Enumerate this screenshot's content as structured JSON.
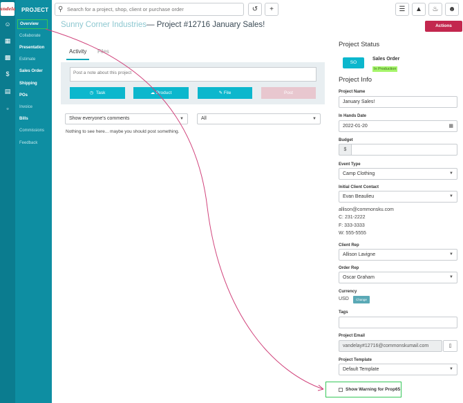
{
  "logo_text": "Vandelay",
  "rail_icons": [
    "users-icon",
    "chart-icon",
    "calculator-icon",
    "dollar-icon",
    "building-icon",
    "book-icon"
  ],
  "nav": {
    "title": "PROJECT",
    "items": [
      {
        "label": "Overview"
      },
      {
        "label": "Collaborate"
      },
      {
        "label": "Presentation"
      },
      {
        "label": "Estimate"
      },
      {
        "label": "Sales Order"
      },
      {
        "label": "Shipping"
      },
      {
        "label": "POs"
      },
      {
        "label": "Invoice"
      },
      {
        "label": "Bills"
      },
      {
        "label": "Commissions"
      },
      {
        "label": "Feedback"
      }
    ]
  },
  "search": {
    "placeholder": "Search for a project, shop, client or purchase order"
  },
  "header": {
    "client": "Sunny Corner Industries",
    "project": "— Project #12716 January Sales!",
    "actions_label": "Actions"
  },
  "tabs": [
    {
      "label": "Activity"
    },
    {
      "label": "Files"
    }
  ],
  "compose": {
    "placeholder": "Post a note about this project",
    "buttons": [
      {
        "label": "Task"
      },
      {
        "label": "Product"
      },
      {
        "label": "File"
      },
      {
        "label": "Post"
      }
    ]
  },
  "filters": {
    "comments": "Show everyone's comments",
    "type": "All"
  },
  "empty_message": "Nothing to see here... maybe you should post something.",
  "status": {
    "heading": "Project Status",
    "badge": "SO",
    "title": "Sales Order",
    "state": "In Production"
  },
  "info": {
    "heading": "Project Info",
    "project_name_label": "Project Name",
    "project_name": "January Sales!",
    "in_hands_label": "In Hands Date",
    "in_hands": "2022-01-20",
    "budget_label": "Budget",
    "budget_prefix": "$",
    "budget": "",
    "event_type_label": "Event Type",
    "event_type": "Camp Clothing",
    "contact_label": "Initial Client Contact",
    "contact": "Evan Beaulieu",
    "contact_lines": [
      "allison@commonsku.com",
      "C: 231-2222",
      "F: 333-3333",
      "W: 555-5555"
    ],
    "client_rep_label": "Client Rep",
    "client_rep": "Allison Lavigne",
    "order_rep_label": "Order Rep",
    "order_rep": "Oscar Graham",
    "currency_label": "Currency",
    "currency": "USD",
    "change_label": "Change",
    "tags_label": "Tags",
    "tags": "",
    "email_label": "Project Email",
    "email": "vandelay#12716@commonskumail.com",
    "template_label": "Project Template",
    "template": "Default Template",
    "prop65_label": "Show Warning for Prop65"
  },
  "colors": {
    "sidebar": "#0e8ea2",
    "accent": "#0cb7cd",
    "actions": "#c3274e",
    "highlight": "#35c759",
    "arrow": "#d0417a"
  }
}
